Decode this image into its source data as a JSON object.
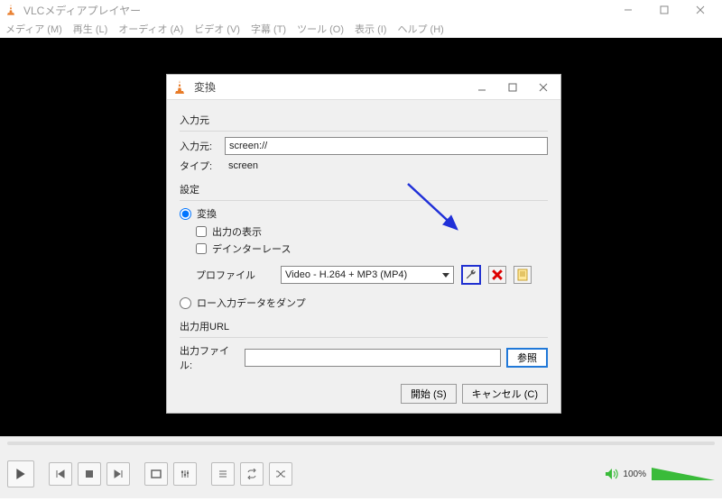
{
  "main_window": {
    "title": "VLCメディアプレイヤー",
    "menu": [
      "メディア (M)",
      "再生 (L)",
      "オーディオ (A)",
      "ビデオ (V)",
      "字幕 (T)",
      "ツール (O)",
      "表示 (I)",
      "ヘルプ (H)"
    ]
  },
  "dialog": {
    "title": "変換",
    "source_section": "入力元",
    "source_label": "入力元:",
    "source_value": "screen://",
    "type_label": "タイプ:",
    "type_value": "screen",
    "settings_section": "設定",
    "radio_convert": "変換",
    "check_display": "出力の表示",
    "check_deinterlace": "デインターレース",
    "profile_label": "プロファイル",
    "profile_value": "Video - H.264 + MP3 (MP4)",
    "radio_dump": "ロー入力データをダンプ",
    "output_section": "出力用URL",
    "output_label": "出力ファイル:",
    "output_value": "",
    "browse_btn": "参照",
    "start_btn": "開始 (S)",
    "cancel_btn": "キャンセル (C)"
  },
  "controls": {
    "volume_pct": "100%"
  }
}
